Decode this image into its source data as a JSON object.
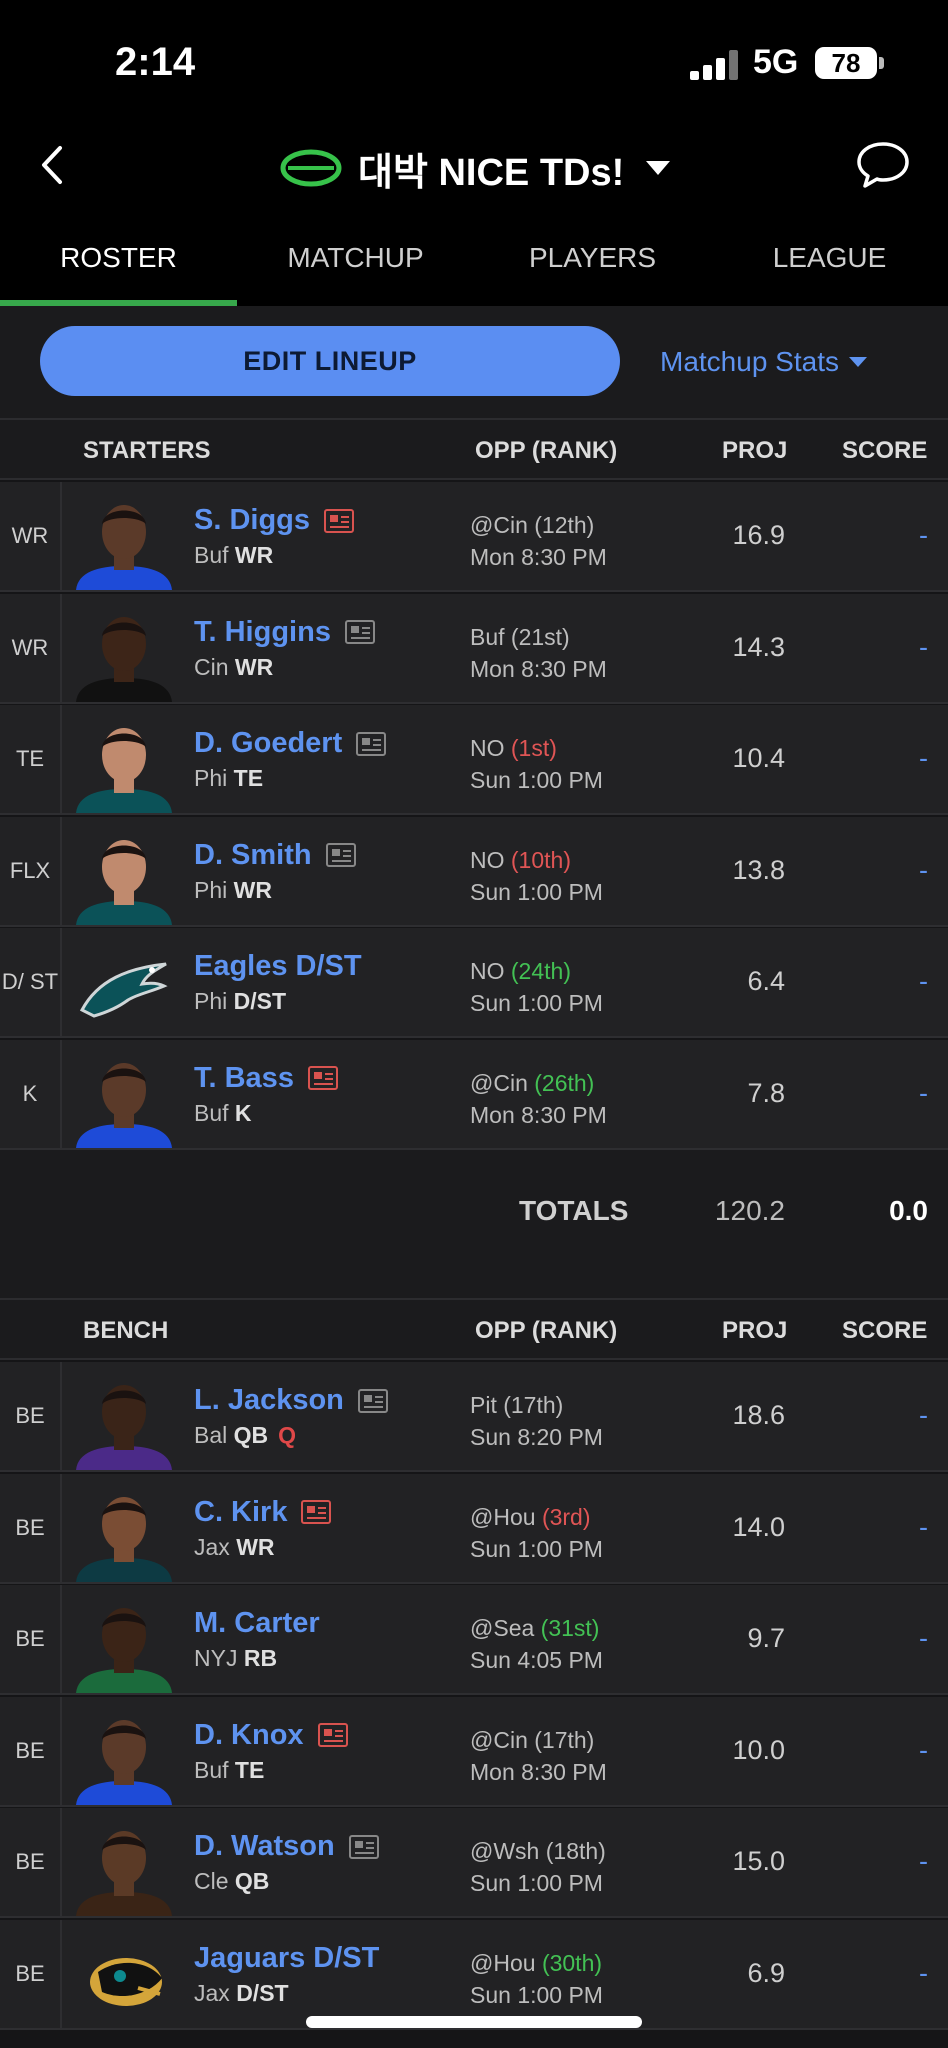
{
  "status_bar": {
    "time": "2:14",
    "network": "5G",
    "battery": "78"
  },
  "header": {
    "team_name": "대박 NICE TDs!"
  },
  "tabs": [
    {
      "label": "ROSTER",
      "active": true
    },
    {
      "label": "MATCHUP",
      "active": false
    },
    {
      "label": "PLAYERS",
      "active": false
    },
    {
      "label": "LEAGUE",
      "active": false
    }
  ],
  "actions": {
    "edit_lineup": "EDIT LINEUP",
    "matchup_stats": "Matchup Stats"
  },
  "starters": {
    "header": {
      "section": "STARTERS",
      "opp": "OPP (RANK)",
      "proj": "PROJ",
      "score": "SCORE"
    },
    "rows": [
      {
        "slot": "WR",
        "name": "S. Diggs",
        "team": "Buf",
        "pos": "WR",
        "news": "hot",
        "opp": "@Cin",
        "rank": "(12th)",
        "rank_color": "n",
        "time": "Mon 8:30 PM",
        "proj": "16.9",
        "score": "-",
        "avatar": "bills"
      },
      {
        "slot": "WR",
        "name": "T. Higgins",
        "team": "Cin",
        "pos": "WR",
        "news": "normal",
        "opp": "Buf",
        "rank": "(21st)",
        "rank_color": "n",
        "time": "Mon 8:30 PM",
        "proj": "14.3",
        "score": "-",
        "avatar": "bengals"
      },
      {
        "slot": "TE",
        "name": "D. Goedert",
        "team": "Phi",
        "pos": "TE",
        "news": "normal",
        "opp": "NO",
        "rank": "(1st)",
        "rank_color": "r",
        "time": "Sun 1:00 PM",
        "proj": "10.4",
        "score": "-",
        "avatar": "eagles"
      },
      {
        "slot": "FLX",
        "name": "D. Smith",
        "team": "Phi",
        "pos": "WR",
        "news": "normal",
        "opp": "NO",
        "rank": "(10th)",
        "rank_color": "r",
        "time": "Sun 1:00 PM",
        "proj": "13.8",
        "score": "-",
        "avatar": "eagles"
      },
      {
        "slot": "D/ ST",
        "name": "Eagles D/ST",
        "team": "Phi",
        "pos": "D/ST",
        "news": "none",
        "opp": "NO",
        "rank": "(24th)",
        "rank_color": "g",
        "time": "Sun 1:00 PM",
        "proj": "6.4",
        "score": "-",
        "avatar": "eagles-logo"
      },
      {
        "slot": "K",
        "name": "T. Bass",
        "team": "Buf",
        "pos": "K",
        "news": "hot",
        "opp": "@Cin",
        "rank": "(26th)",
        "rank_color": "g",
        "time": "Mon 8:30 PM",
        "proj": "7.8",
        "score": "-",
        "avatar": "bills"
      }
    ]
  },
  "totals": {
    "label": "TOTALS",
    "proj": "120.2",
    "score": "0.0"
  },
  "bench": {
    "header": {
      "section": "BENCH",
      "opp": "OPP (RANK)",
      "proj": "PROJ",
      "score": "SCORE"
    },
    "rows": [
      {
        "slot": "BE",
        "name": "L. Jackson",
        "team": "Bal",
        "pos": "QB",
        "injury": "Q",
        "news": "normal",
        "opp": "Pit",
        "rank": "(17th)",
        "rank_color": "n",
        "time": "Sun 8:20 PM",
        "proj": "18.6",
        "score": "-",
        "avatar": "ravens"
      },
      {
        "slot": "BE",
        "name": "C. Kirk",
        "team": "Jax",
        "pos": "WR",
        "news": "hot",
        "opp": "@Hou",
        "rank": "(3rd)",
        "rank_color": "r",
        "time": "Sun 1:00 PM",
        "proj": "14.0",
        "score": "-",
        "avatar": "jaguars"
      },
      {
        "slot": "BE",
        "name": "M. Carter",
        "team": "NYJ",
        "pos": "RB",
        "news": "none",
        "opp": "@Sea",
        "rank": "(31st)",
        "rank_color": "g",
        "time": "Sun 4:05 PM",
        "proj": "9.7",
        "score": "-",
        "avatar": "jets"
      },
      {
        "slot": "BE",
        "name": "D. Knox",
        "team": "Buf",
        "pos": "TE",
        "news": "hot",
        "opp": "@Cin",
        "rank": "(17th)",
        "rank_color": "n",
        "time": "Mon 8:30 PM",
        "proj": "10.0",
        "score": "-",
        "avatar": "bills"
      },
      {
        "slot": "BE",
        "name": "D. Watson",
        "team": "Cle",
        "pos": "QB",
        "news": "normal",
        "opp": "@Wsh",
        "rank": "(18th)",
        "rank_color": "n",
        "time": "Sun 1:00 PM",
        "proj": "15.0",
        "score": "-",
        "avatar": "browns"
      },
      {
        "slot": "BE",
        "name": "Jaguars D/ST",
        "team": "Jax",
        "pos": "D/ST",
        "news": "none",
        "opp": "@Hou",
        "rank": "(30th)",
        "rank_color": "g",
        "time": "Sun 1:00 PM",
        "proj": "6.9",
        "score": "-",
        "avatar": "jaguars-logo"
      }
    ]
  },
  "colors": {
    "accent_green": "#37a84b",
    "link_blue": "#5e93f0",
    "button_blue": "#5b8ef2",
    "rank_red": "#e05555",
    "rank_green": "#43c154"
  },
  "icons": [
    "back-chevron-icon",
    "football-icon",
    "caret-down-icon",
    "chat-bubble-icon",
    "news-icon"
  ]
}
